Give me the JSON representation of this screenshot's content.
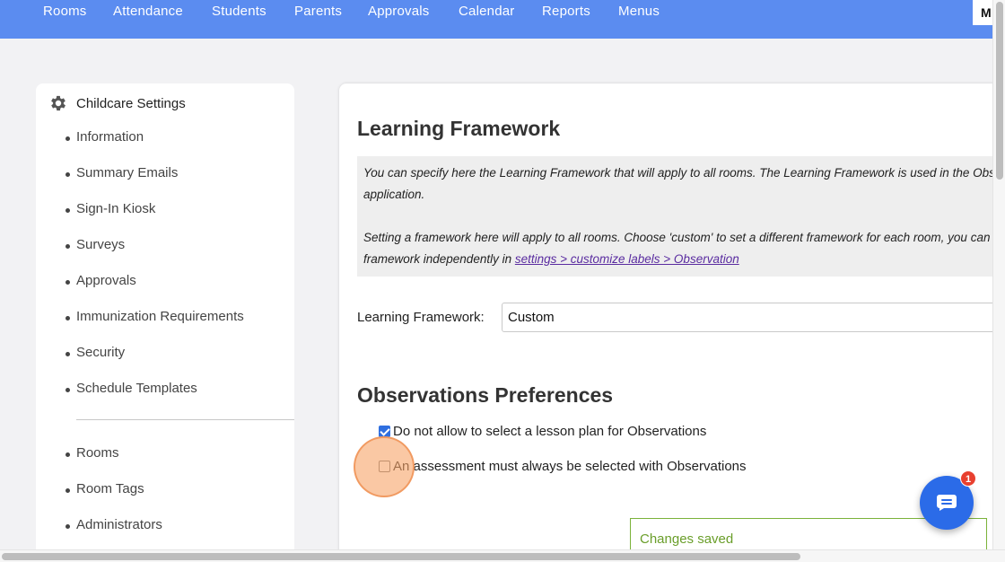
{
  "nav": {
    "items": [
      {
        "label": "Rooms"
      },
      {
        "label": "Attendance"
      },
      {
        "label": "Students"
      },
      {
        "label": "Parents"
      },
      {
        "label": "Approvals"
      },
      {
        "label": "Calendar"
      },
      {
        "label": "Reports"
      },
      {
        "label": "Menus"
      }
    ],
    "user_initial": "M"
  },
  "sidebar": {
    "title": "Childcare Settings",
    "title_icon": "gear-icon",
    "items": [
      {
        "label": "Information"
      },
      {
        "label": "Summary Emails"
      },
      {
        "label": "Sign-In Kiosk"
      },
      {
        "label": "Surveys"
      },
      {
        "label": "Approvals"
      },
      {
        "label": "Immunization Requirements"
      },
      {
        "label": "Security"
      },
      {
        "label": "Schedule Templates"
      }
    ],
    "items2": [
      {
        "label": "Rooms"
      },
      {
        "label": "Room Tags"
      },
      {
        "label": "Administrators"
      }
    ]
  },
  "main": {
    "title": "Learning Framework",
    "info": {
      "line1": "You can specify here the Learning Framework that will apply to all rooms. The Learning Framework is used in the Obs",
      "line2": "application.",
      "line3": "Setting a framework here will apply to all rooms. Choose 'custom' to set a different framework for each room, you can",
      "line4_prefix": "framework independently in ",
      "link": "settings > customize labels > Observation"
    },
    "framework_label": "Learning Framework:",
    "framework_value": "Custom",
    "section_title": "Observations Preferences",
    "checkboxes": [
      {
        "label": "Do not allow to select a lesson plan for Observations",
        "checked": true
      },
      {
        "label": "An assessment must always be selected with Observations",
        "checked": false
      }
    ],
    "saved_message": "Changes saved"
  },
  "chat": {
    "badge_count": "1"
  },
  "colors": {
    "nav_bg": "#5b8cf0",
    "accent": "#2b6be8",
    "badge": "#e8402f",
    "success": "#6a9e2a"
  }
}
